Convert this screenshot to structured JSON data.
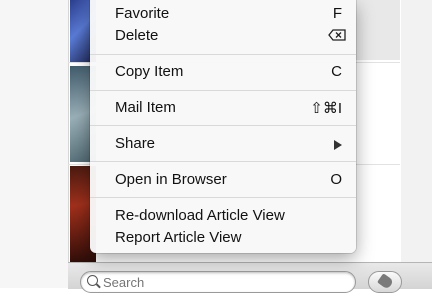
{
  "menu": {
    "items": [
      {
        "label": "Favorite",
        "shortcut": "F"
      },
      {
        "label": "Delete",
        "shortcut_icon": "delete-key-icon"
      },
      {
        "label": "Copy Item",
        "shortcut": "C"
      },
      {
        "label": "Mail Item",
        "shortcut": "⇧⌘I"
      },
      {
        "label": "Share",
        "shortcut_icon": "submenu-arrow-icon"
      },
      {
        "label": "Open in Browser",
        "shortcut": "O"
      },
      {
        "label": "Re-download Article View"
      },
      {
        "label": "Report Article View"
      }
    ]
  },
  "search": {
    "placeholder": "Search"
  },
  "icons": {
    "search": "magnifier-icon",
    "tag": "tag-icon"
  }
}
